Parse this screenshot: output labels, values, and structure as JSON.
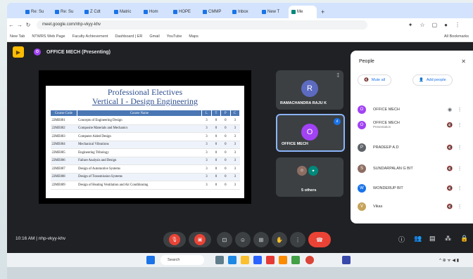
{
  "browser": {
    "tabs": [
      "Re: Su",
      "Re: Su",
      "Z Cdt",
      "Matric",
      "Hom",
      "HOPE",
      "CMMP",
      "Inbox",
      "New T",
      "Me"
    ],
    "address": "meet.google.com/nhp-vkyy-khv",
    "bookmarks": [
      "New Tab",
      "NTWRS Web Page",
      "Faculty Achievement",
      "Dashboard | ER",
      "Gmail",
      "YouTube",
      "Maps",
      "All Bookmarks"
    ]
  },
  "meeting": {
    "presenter_label": "OFFICE MECH (Presenting)",
    "meeting_code": "nhp-vkyy-khv",
    "time": "10:16 AM"
  },
  "slide": {
    "title": "Professional Electives",
    "subtitle": "Vertical I - Design Engineering",
    "headers": [
      "Course Code",
      "Course Name",
      "L",
      "T",
      "P",
      "C"
    ],
    "rows": [
      [
        "22ME001",
        "Concepts of Engineering Design",
        "3",
        "0",
        "0",
        "3"
      ],
      [
        "22ME002",
        "Composite Materials and Mechanics",
        "3",
        "0",
        "0",
        "3"
      ],
      [
        "22ME003",
        "Computer Aided Design",
        "3",
        "0",
        "0",
        "3"
      ],
      [
        "22ME004",
        "Mechanical Vibrations",
        "3",
        "0",
        "0",
        "3"
      ],
      [
        "22ME005",
        "Engineering Tribology",
        "3",
        "0",
        "0",
        "3"
      ],
      [
        "22ME006",
        "Failure Analysis and Design",
        "3",
        "0",
        "0",
        "3"
      ],
      [
        "22ME007",
        "Design of Automotive Systems",
        "3",
        "0",
        "0",
        "3"
      ],
      [
        "22ME008",
        "Design of Transmission Systems",
        "3",
        "0",
        "0",
        "3"
      ],
      [
        "22ME009",
        "Design of Heating Ventilation and Air Conditioning",
        "3",
        "0",
        "0",
        "3"
      ]
    ]
  },
  "tiles": {
    "tile1_initial": "R",
    "tile1_name": "RAMACHANDRA RAJU K",
    "tile2_initial": "O",
    "tile2_name": "OFFICE MECH",
    "tile3_name": "5 others"
  },
  "people": {
    "heading": "People",
    "mute_all": "Mute all",
    "add_people": "Add people",
    "list": [
      {
        "initial": "O",
        "name": "OFFICE MECH",
        "sub": "",
        "color": "#a142f4"
      },
      {
        "initial": "O",
        "name": "OFFICE MECH",
        "sub": "Presentation",
        "color": "#a142f4"
      },
      {
        "initial": "P",
        "name": "PRADEEP A.D",
        "sub": "",
        "color": "#5f6368"
      },
      {
        "initial": "S",
        "name": "SUNDARPALAN G BIT",
        "sub": "",
        "color": "#8d6e63"
      },
      {
        "initial": "W",
        "name": "WONDERUP BIT",
        "sub": "",
        "color": "#1a73e8"
      },
      {
        "initial": "V",
        "name": "Vikas",
        "sub": "",
        "color": "#c5a35a"
      }
    ]
  },
  "taskbar": {
    "search": "Search"
  }
}
